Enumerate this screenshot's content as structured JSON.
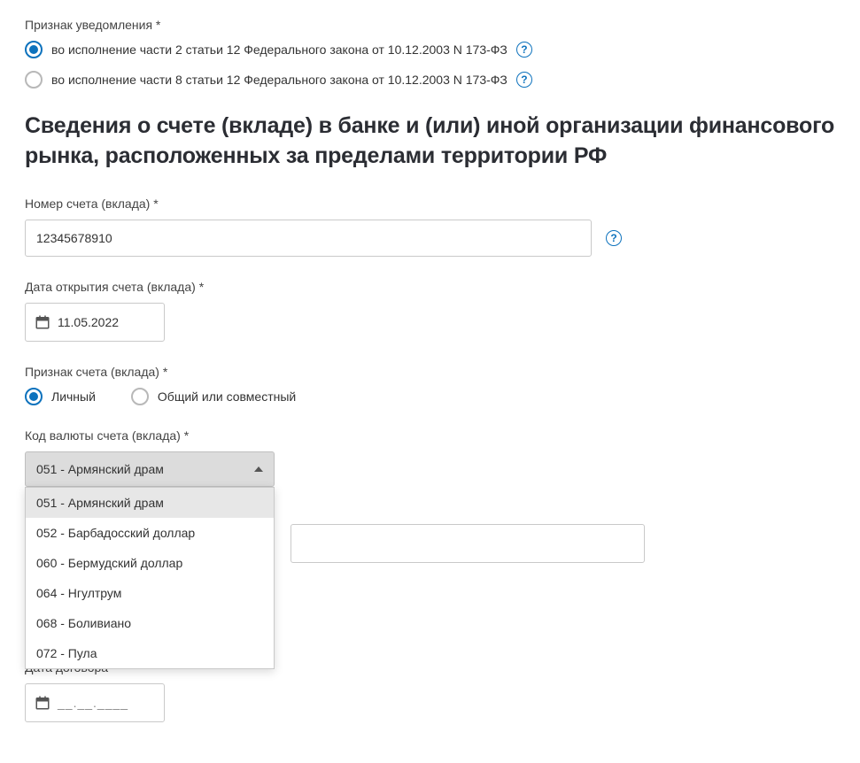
{
  "notificationSign": {
    "label": "Признак уведомления *",
    "options": [
      "во исполнение части 2 статьи 12 Федерального закона от 10.12.2003 N 173-ФЗ",
      "во исполнение части 8 статьи 12 Федерального закона от 10.12.2003 N 173-ФЗ"
    ]
  },
  "sectionHeading": "Сведения о счете (вкладе) в банке и (или) иной организации финансового рынка, расположенных за пределами территории РФ",
  "accountNumber": {
    "label": "Номер счета (вклада) *",
    "value": "12345678910"
  },
  "openDate": {
    "label": "Дата открытия счета (вклада) *",
    "value": "11.05.2022"
  },
  "accountSign": {
    "label": "Признак счета (вклада) *",
    "options": [
      "Личный",
      "Общий или совместный"
    ]
  },
  "currency": {
    "label": "Код валюты счета (вклада) *",
    "selected": "051 - Армянский драм",
    "options": [
      "051 - Армянский драм",
      "052 - Барбадосский доллар",
      "060 - Бермудский доллар",
      "064 - Нгултрум",
      "068 - Боливиано",
      "072 - Пула"
    ]
  },
  "contractDate": {
    "label": "Дата договора",
    "placeholder": "__.__.____"
  },
  "helpGlyph": "?"
}
